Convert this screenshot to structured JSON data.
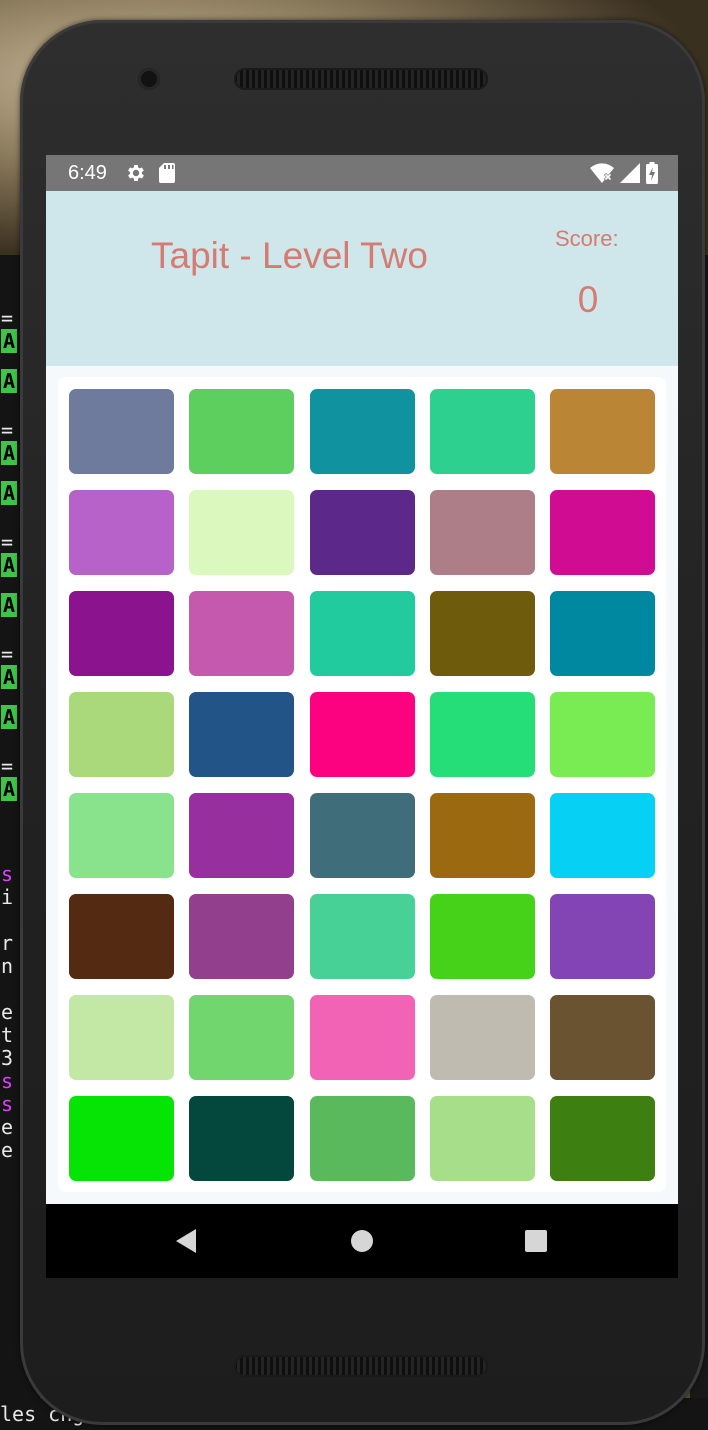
{
  "status_bar": {
    "time": "6:49"
  },
  "header": {
    "title": "Tapit - Level Two",
    "score_label": "Score:",
    "score_value": "0"
  },
  "grid": {
    "rows": [
      [
        "#6e7b9c",
        "#5ccf5e",
        "#10939f",
        "#2ed090",
        "#bb8536"
      ],
      [
        "#b762c8",
        "#dbf9bf",
        "#5c288a",
        "#ae7e88",
        "#d00c92"
      ],
      [
        "#8c138e",
        "#c459ae",
        "#21cb9e",
        "#6e5b0b",
        "#0088a0"
      ],
      [
        "#a9d97b",
        "#235488",
        "#fc0281",
        "#25de78",
        "#78ec52"
      ],
      [
        "#88e38c",
        "#972f9f",
        "#3f6e7a",
        "#9a6910",
        "#06d0f4"
      ],
      [
        "#552a13",
        "#923f8d",
        "#48d196",
        "#45d218",
        "#8445b4"
      ],
      [
        "#c3e8a5",
        "#72d66e",
        "#f263b6",
        "#c0bbb0",
        "#6a5330"
      ],
      [
        "#05e405",
        "#03473d",
        "#5bb95d",
        "#a6de8a",
        "#3e7f12"
      ]
    ]
  },
  "terminal": {
    "bottom_text": "les chg",
    "left_lines": [
      "=",
      "A",
      "",
      "A",
      "",
      "=",
      "A",
      "",
      "A",
      "",
      "=",
      "A",
      "",
      "A",
      "",
      "=",
      "A",
      "",
      "A",
      "",
      "=",
      "A"
    ],
    "left_lines_2": [
      "s",
      "i",
      "",
      "r",
      "n",
      "",
      "e",
      "t",
      "3",
      "s",
      "s",
      "e",
      "e"
    ]
  }
}
